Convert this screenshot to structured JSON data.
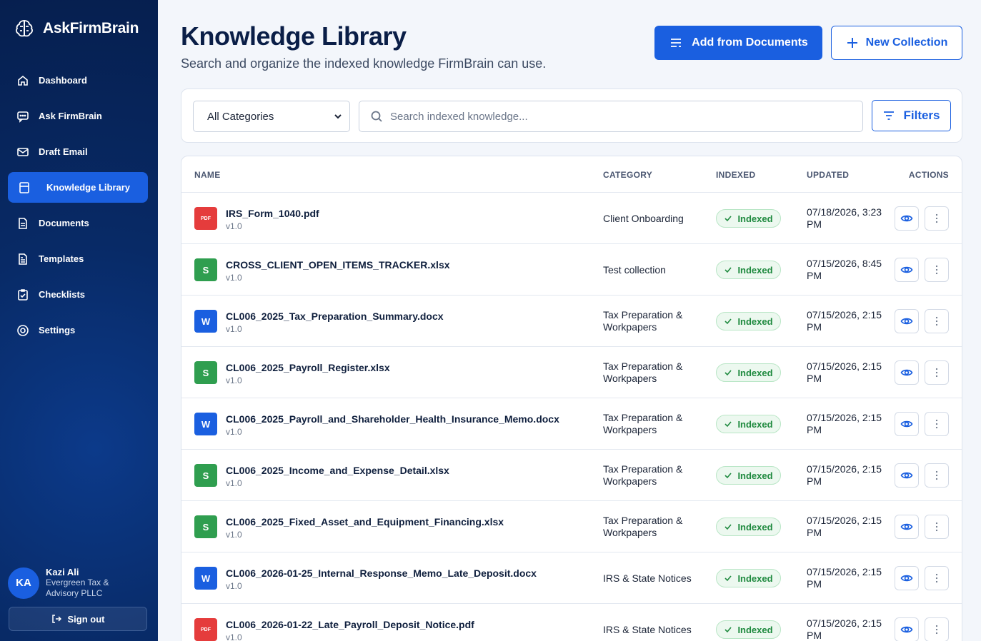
{
  "app": {
    "name": "AskFirmBrain"
  },
  "sidebar": {
    "items": [
      {
        "label": "Dashboard",
        "icon": "home-icon"
      },
      {
        "label": "Ask FirmBrain",
        "icon": "chat-icon"
      },
      {
        "label": "Draft Email",
        "icon": "mail-icon"
      },
      {
        "label": "Knowledge Library",
        "icon": "book-icon",
        "active": true
      },
      {
        "label": "Documents",
        "icon": "document-icon"
      },
      {
        "label": "Templates",
        "icon": "template-icon"
      },
      {
        "label": "Checklists",
        "icon": "checklist-icon"
      },
      {
        "label": "Settings",
        "icon": "settings-icon"
      }
    ],
    "user": {
      "initials": "KA",
      "name": "Kazi Ali",
      "org": "Evergreen Tax & Advisory PLLC"
    },
    "signout_label": "Sign out"
  },
  "header": {
    "title": "Knowledge Library",
    "subtitle": "Search and organize the indexed knowledge FirmBrain can use.",
    "add_button": "Add from Documents",
    "new_button": "New Collection"
  },
  "filters": {
    "category_selected": "All Categories",
    "search_placeholder": "Search indexed knowledge...",
    "filters_button": "Filters"
  },
  "table": {
    "columns": {
      "name": "NAME",
      "category": "CATEGORY",
      "indexed": "INDEXED",
      "updated": "UPDATED",
      "actions": "ACTIONS"
    },
    "rows": [
      {
        "type": "pdf",
        "type_label": "PDF",
        "name": "IRS_Form_1040.pdf",
        "version": "v1.0",
        "category": "Client Onboarding",
        "status": "Indexed",
        "updated": "07/18/2026, 3:23 PM"
      },
      {
        "type": "xlsx",
        "type_label": "S",
        "name": "CROSS_CLIENT_OPEN_ITEMS_TRACKER.xlsx",
        "version": "v1.0",
        "category": "Test collection",
        "status": "Indexed",
        "updated": "07/15/2026, 8:45 PM"
      },
      {
        "type": "docx",
        "type_label": "W",
        "name": "CL006_2025_Tax_Preparation_Summary.docx",
        "version": "v1.0",
        "category": "Tax Preparation & Workpapers",
        "status": "Indexed",
        "updated": "07/15/2026, 2:15 PM"
      },
      {
        "type": "xlsx",
        "type_label": "S",
        "name": "CL006_2025_Payroll_Register.xlsx",
        "version": "v1.0",
        "category": "Tax Preparation & Workpapers",
        "status": "Indexed",
        "updated": "07/15/2026, 2:15 PM"
      },
      {
        "type": "docx",
        "type_label": "W",
        "name": "CL006_2025_Payroll_and_Shareholder_Health_Insurance_Memo.docx",
        "version": "v1.0",
        "category": "Tax Preparation & Workpapers",
        "status": "Indexed",
        "updated": "07/15/2026, 2:15 PM"
      },
      {
        "type": "xlsx",
        "type_label": "S",
        "name": "CL006_2025_Income_and_Expense_Detail.xlsx",
        "version": "v1.0",
        "category": "Tax Preparation & Workpapers",
        "status": "Indexed",
        "updated": "07/15/2026, 2:15 PM"
      },
      {
        "type": "xlsx",
        "type_label": "S",
        "name": "CL006_2025_Fixed_Asset_and_Equipment_Financing.xlsx",
        "version": "v1.0",
        "category": "Tax Preparation & Workpapers",
        "status": "Indexed",
        "updated": "07/15/2026, 2:15 PM"
      },
      {
        "type": "docx",
        "type_label": "W",
        "name": "CL006_2026-01-25_Internal_Response_Memo_Late_Deposit.docx",
        "version": "v1.0",
        "category": "IRS & State Notices",
        "status": "Indexed",
        "updated": "07/15/2026, 2:15 PM"
      },
      {
        "type": "pdf",
        "type_label": "PDF",
        "name": "CL006_2026-01-22_Late_Payroll_Deposit_Notice.pdf",
        "version": "v1.0",
        "category": "IRS & State Notices",
        "status": "Indexed",
        "updated": "07/15/2026, 2:15 PM"
      }
    ]
  },
  "colors": {
    "accent": "#1a5fe0",
    "sidebar": "#082a66",
    "success": "#1f8a3f",
    "pdf": "#e53c3c",
    "xlsx": "#2f9e4f",
    "docx": "#1a5fe0"
  }
}
